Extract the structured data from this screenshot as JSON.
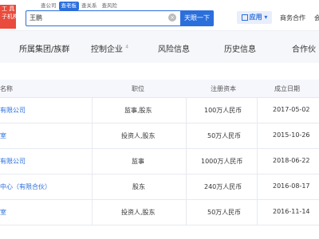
{
  "logo": {
    "line1": "工 具",
    "line2": "子机构"
  },
  "scopes": [
    "查公司",
    "查老板",
    "查关系",
    "查风险"
  ],
  "search": {
    "value": "王鹏",
    "button": "天眼一下"
  },
  "header": {
    "apps_label": "应用",
    "biz_label": "商务合作",
    "biz2_label": "会"
  },
  "tabs": [
    {
      "label": "所属集团/族群",
      "count": ""
    },
    {
      "label": "控制企业",
      "count": "4"
    },
    {
      "label": "风险信息",
      "count": ""
    },
    {
      "label": "历史信息",
      "count": ""
    },
    {
      "label": "合作伙",
      "count": ""
    }
  ],
  "table": {
    "headers": [
      "名称",
      "职位",
      "注册资本",
      "成立日期"
    ],
    "rows": [
      {
        "name": "有限公司",
        "position": "监事,股东",
        "capital": "100万人民币",
        "date": "2017-05-02"
      },
      {
        "name": "室",
        "position": "投资人,股东",
        "capital": "50万人民币",
        "date": "2015-10-26"
      },
      {
        "name": "有限公司",
        "position": "监事",
        "capital": "1000万人民币",
        "date": "2018-06-22"
      },
      {
        "name": "中心（有限合伙）",
        "position": "股东",
        "capital": "240万人民币",
        "date": "2016-08-17"
      },
      {
        "name": "室",
        "position": "投资人,股东",
        "capital": "50万人民币",
        "date": "2016-11-14"
      }
    ]
  }
}
